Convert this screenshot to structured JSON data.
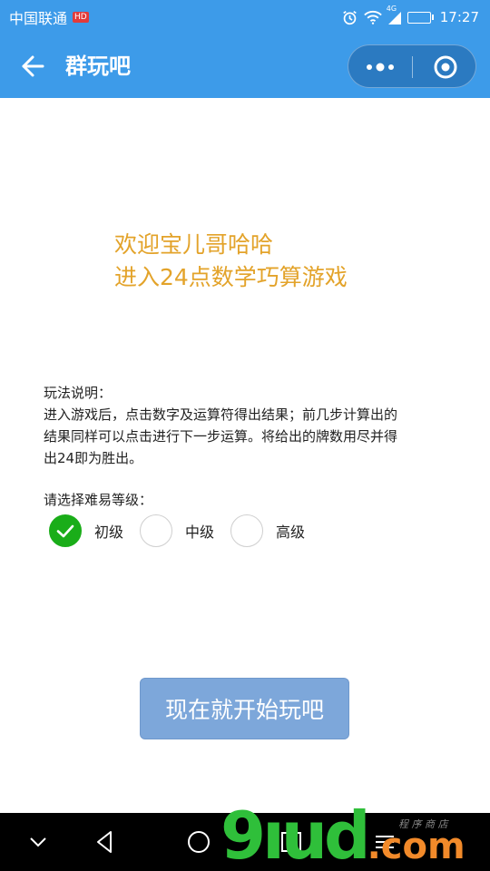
{
  "status_bar": {
    "carrier": "中国联通",
    "carrier_badge": "HD",
    "network": "4G",
    "time": "17:27",
    "battery_level": 0.3,
    "icons": [
      "alarm-icon",
      "wifi-icon",
      "signal-icon",
      "battery-icon"
    ]
  },
  "nav": {
    "title": "群玩吧",
    "icons": [
      "back-arrow-icon",
      "more-dots-icon",
      "close-target-icon"
    ]
  },
  "welcome": {
    "line1": "欢迎宝儿哥哈哈",
    "line2": "进入24点数学巧算游戏"
  },
  "rules": {
    "title": "玩法说明：",
    "line1": "进入游戏后，点击数字及运算符得出结果；前几步计算出的",
    "line2": "结果同样可以点击进行下一步运算。将给出的牌数用尽并得",
    "line3": "出24即为胜出。"
  },
  "difficulty": {
    "label": "请选择难易等级：",
    "options": [
      {
        "label": "初级",
        "selected": true
      },
      {
        "label": "中级",
        "selected": false
      },
      {
        "label": "高级",
        "selected": false
      }
    ]
  },
  "start_button": {
    "label": "现在就开始玩吧"
  },
  "watermark": {
    "main": "9ıud",
    "suffix": ".com",
    "small": "程 序 商 店"
  },
  "colors": {
    "header": "#3d9be9",
    "welcome_text": "#e3a32a",
    "check_green": "#1aad19",
    "button": "#7da7da"
  }
}
